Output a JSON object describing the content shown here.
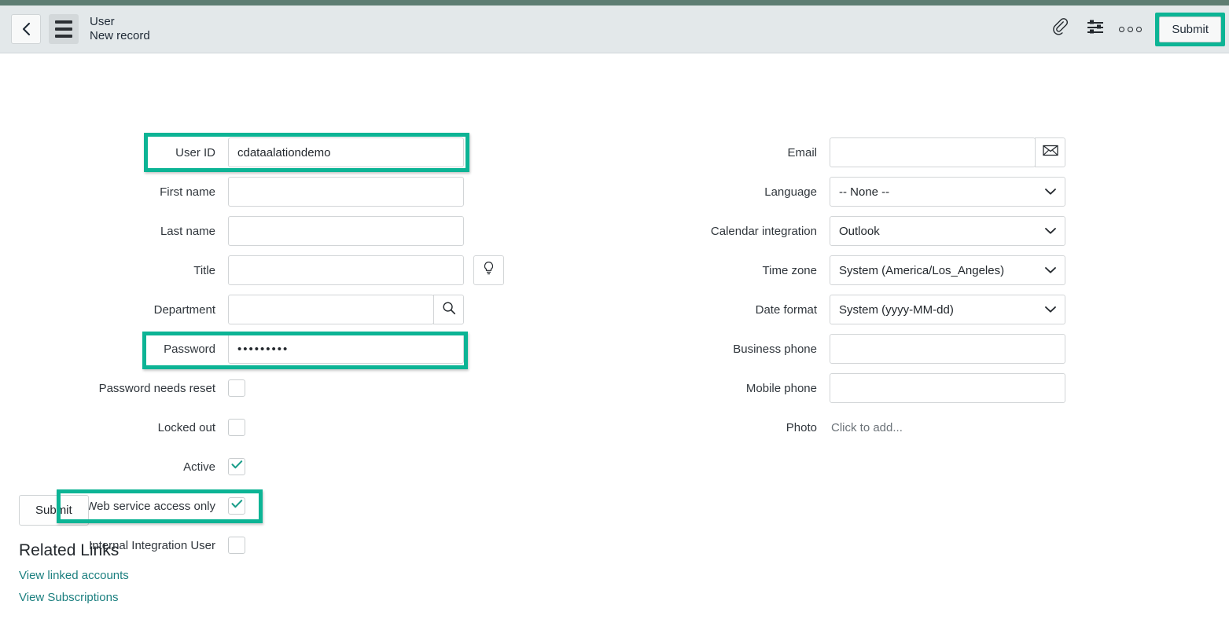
{
  "header": {
    "back_icon": "chevron-left-icon",
    "menu_icon": "hamburger-menu-icon",
    "title": "User",
    "subtitle": "New record",
    "attachment_icon": "paperclip-icon",
    "personalize_icon": "sliders-filter-icon",
    "more_icon": "three-dots-icon",
    "submit_label": "Submit"
  },
  "left_fields": {
    "user_id": {
      "label": "User ID",
      "value": "cdataalationdemo",
      "highlighted": true
    },
    "first_name": {
      "label": "First name",
      "value": ""
    },
    "last_name": {
      "label": "Last name",
      "value": ""
    },
    "title": {
      "label": "Title",
      "value": "",
      "addon_icon": "lightbulb-icon"
    },
    "department": {
      "label": "Department",
      "value": "",
      "addon_icon": "search-icon"
    },
    "password": {
      "label": "Password",
      "value": "•••••••••",
      "highlighted": true
    },
    "password_needs_reset": {
      "label": "Password needs reset",
      "checked": false
    },
    "locked_out": {
      "label": "Locked out",
      "checked": false
    },
    "active": {
      "label": "Active",
      "checked": true
    },
    "web_service_access_only": {
      "label": "Web service access only",
      "checked": true,
      "highlighted": true
    },
    "internal_integration_user": {
      "label": "Internal Integration User",
      "checked": false
    }
  },
  "right_fields": {
    "email": {
      "label": "Email",
      "value": "",
      "addon_icon": "envelope-icon"
    },
    "language": {
      "label": "Language",
      "value": "-- None --",
      "type": "select"
    },
    "calendar_integration": {
      "label": "Calendar integration",
      "value": "Outlook",
      "type": "select"
    },
    "time_zone": {
      "label": "Time zone",
      "value": "System (America/Los_Angeles)",
      "type": "select"
    },
    "date_format": {
      "label": "Date format",
      "value": "System (yyyy-MM-dd)",
      "type": "select"
    },
    "business_phone": {
      "label": "Business phone",
      "value": ""
    },
    "mobile_phone": {
      "label": "Mobile phone",
      "value": ""
    },
    "photo": {
      "label": "Photo",
      "value": "Click to add..."
    }
  },
  "bottom": {
    "submit_label": "Submit",
    "related_links_title": "Related Links",
    "links": [
      {
        "label": "View linked accounts"
      },
      {
        "label": "View Subscriptions"
      }
    ]
  },
  "colors": {
    "highlight": "#0cb495",
    "accent_link": "#1b7f7f",
    "top_strip": "#5e7d72",
    "header_bg": "#e3e8ea",
    "check": "#1b9e8a"
  }
}
